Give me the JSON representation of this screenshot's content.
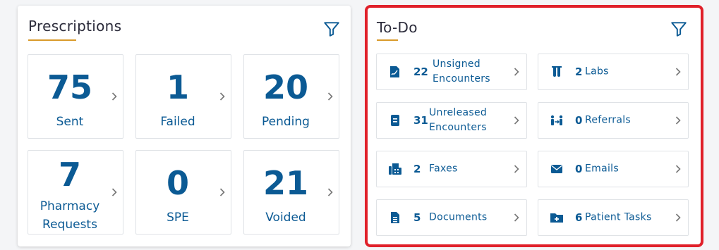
{
  "prescriptions": {
    "title": "Prescriptions",
    "tiles": [
      {
        "count": "75",
        "label": "Sent"
      },
      {
        "count": "1",
        "label": "Failed"
      },
      {
        "count": "20",
        "label": "Pending"
      },
      {
        "count": "7",
        "label_line1": "Pharmacy",
        "label_line2": "Requests"
      },
      {
        "count": "0",
        "label": "SPE"
      },
      {
        "count": "21",
        "label": "Voided"
      }
    ]
  },
  "todo": {
    "title": "To-Do",
    "items": [
      {
        "count": "22",
        "label_line1": "Unsigned",
        "label_line2": "Encounters",
        "icon": "signature-document-icon"
      },
      {
        "count": "2",
        "label": "Labs",
        "icon": "lab-flasks-icon"
      },
      {
        "count": "31",
        "label_line1": "Unreleased",
        "label_line2": "Encounters",
        "icon": "document-icon"
      },
      {
        "count": "0",
        "label": "Referrals",
        "icon": "referral-people-icon"
      },
      {
        "count": "2",
        "label": "Faxes",
        "icon": "fax-machine-icon"
      },
      {
        "count": "0",
        "label": "Emails",
        "icon": "email-icon"
      },
      {
        "count": "5",
        "label": "Documents",
        "icon": "file-icon"
      },
      {
        "count": "6",
        "label": "Patient Tasks",
        "icon": "folder-plus-icon"
      }
    ]
  },
  "colors": {
    "accent": "#0b5a94",
    "underline": "#d99a2b",
    "highlight_border": "#e0202a"
  }
}
